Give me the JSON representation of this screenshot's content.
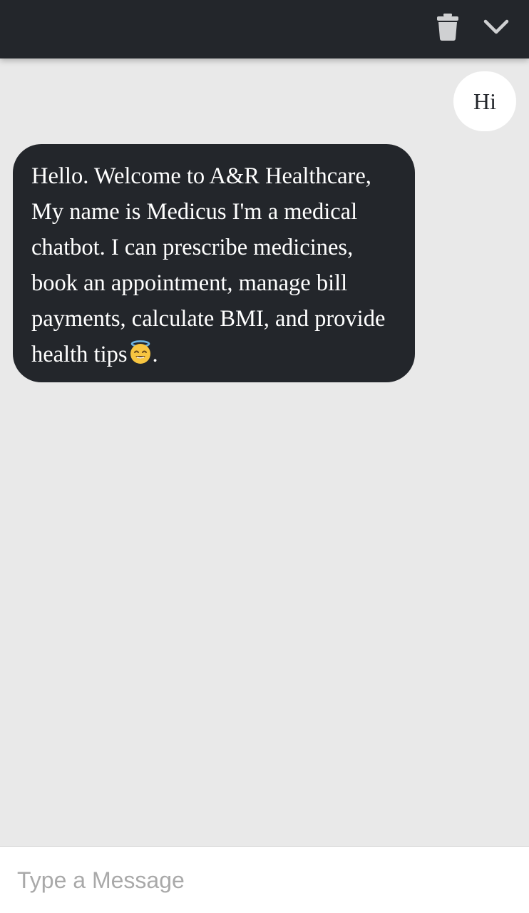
{
  "header": {
    "icons": [
      "trash-icon",
      "chevron-down-icon"
    ],
    "background": "#23262b"
  },
  "messages": {
    "user": [
      {
        "text": "Hi"
      }
    ],
    "bot": [
      {
        "text": "Hello. Welcome to A&R Healthcare, My name is Medicus I'm a medical chatbot. I can prescribe medicines, book an appointment, manage bill payments, calculate BMI, and provide health tips",
        "emoji": "smiling-face-with-halo",
        "trailing": "."
      }
    ]
  },
  "composer": {
    "placeholder": "Type a Message",
    "value": ""
  },
  "colors": {
    "chat_background": "#e9e9e9",
    "bot_bubble": "#23262b",
    "user_bubble": "#ffffff",
    "icon": "#cfd0d2"
  }
}
